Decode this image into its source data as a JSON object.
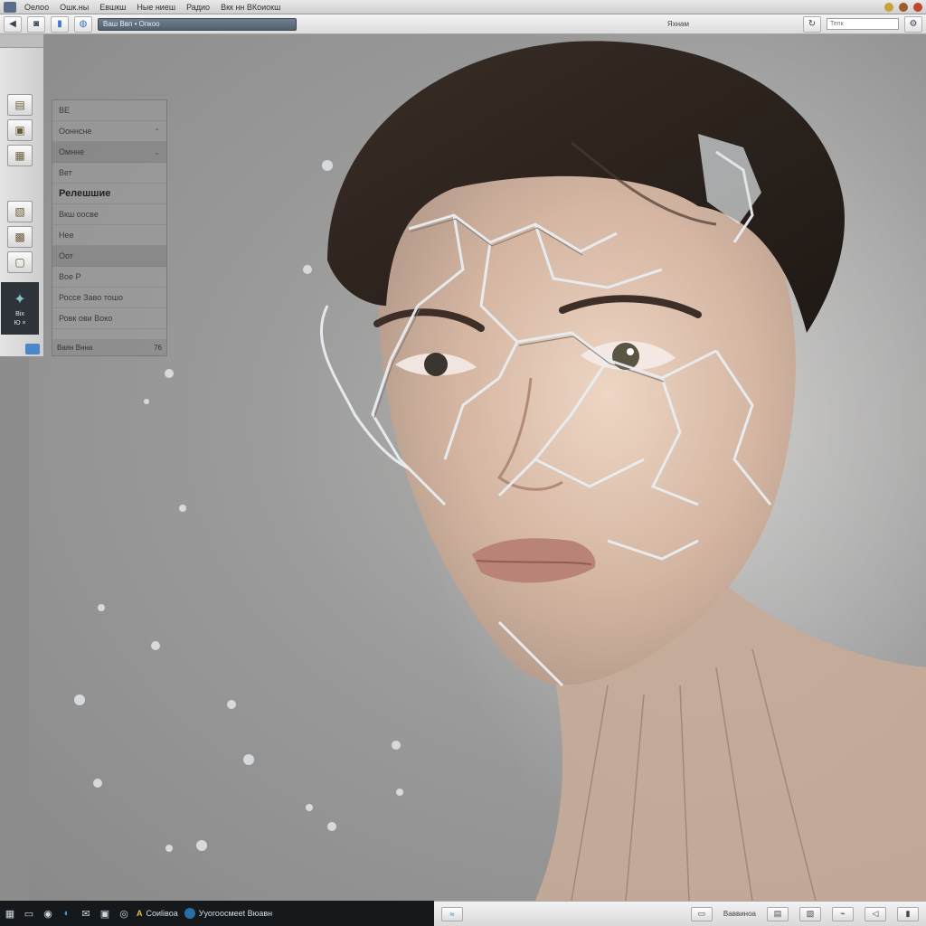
{
  "titlebar": {
    "menu": [
      "Оелоо",
      "Ошк.ны",
      "Евшкш",
      "Ные ниеш",
      "Радио",
      "Вкк нн ВКоиокш"
    ],
    "icons": [
      "app-icon",
      "minimize-icon",
      "maximize-icon",
      "close-icon"
    ]
  },
  "toolbar": {
    "address": "Ваш Ввп • Опкоо",
    "center_label": "Яхнам",
    "search_placeholder": "Тепк",
    "icons": [
      "back-icon",
      "camera-icon",
      "document-icon",
      "globe-icon",
      "refresh-icon",
      "settings-icon"
    ]
  },
  "left_dock": {
    "tiles": [
      "folder-icon",
      "box-icon",
      "package-icon",
      "image-icon",
      "car-icon",
      "frame-icon"
    ],
    "active": {
      "icon": "bird-icon",
      "top": "Віх",
      "bottom": "Ю ×"
    }
  },
  "panel": {
    "header": "ВЕ",
    "rows": [
      {
        "label": "Ооннсне",
        "chev": "⌃"
      },
      {
        "label": "Омнне",
        "chev": "⌄"
      },
      {
        "label": "Вет",
        "chev": ""
      },
      {
        "label": "Релешшие",
        "chev": ""
      },
      {
        "label": "Вкш оосве",
        "chev": ""
      },
      {
        "label": "Нее",
        "chev": ""
      },
      {
        "label": "Оот",
        "chev": ""
      },
      {
        "label": "Вое Р",
        "chev": ""
      },
      {
        "label": "Россе Заво тошо",
        "chev": ""
      },
      {
        "label": "Ровк ови Воко",
        "chev": ""
      }
    ],
    "footer": "Ваян Внна",
    "footer_num": "76"
  },
  "artwork": {
    "palette": {
      "background": "#9b9b9b",
      "skin": "#dcc1ad",
      "hair": "#2a211c",
      "lips": "#b98378",
      "glass": "#e8eef2"
    }
  },
  "taskbar": {
    "icons": [
      "windows-icon",
      "task-view-icon",
      "browser-icon",
      "edge-icon",
      "mail-icon",
      "store-icon",
      "record-icon"
    ],
    "item1": "Соиlівоа",
    "item2": "Ууогоосмееt Вюавн"
  },
  "statusbar": {
    "label": "Ваввиноа",
    "icons": [
      "status-wifi-icon",
      "status-file-icon",
      "status-folder-icon",
      "status-image-icon",
      "status-link-icon",
      "status-volume-icon",
      "status-battery-icon"
    ]
  }
}
